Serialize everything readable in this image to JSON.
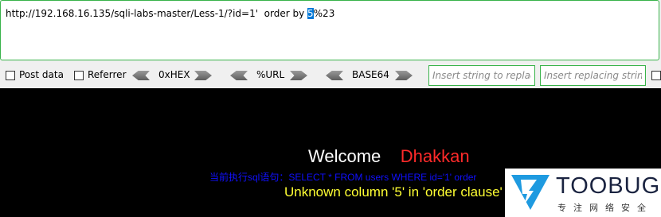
{
  "url_bar": {
    "prefix": "http://192.168.16.135/sqli-labs-master/Less-1/?id=1'  order by",
    "selected": "5",
    "suffix": "%23"
  },
  "toolbar": {
    "post_data_label": "Post data",
    "referrer_label": "Referrer",
    "hex_label": "0xHEX",
    "url_label": "%URL",
    "base64_label": "BASE64",
    "insert_string_placeholder": "Insert string to replace",
    "insert_replacing_placeholder": "Insert replacing string"
  },
  "page": {
    "welcome_text": "Welcome",
    "welcome_name": "Dhakkan",
    "sql_line": "当前执行sql语句：SELECT * FROM users WHERE id='1' order",
    "error_line": "Unknown column '5' in 'order clause'"
  },
  "watermark": {
    "brand": "TOOBUG",
    "subtitle": "专注网络安全"
  },
  "colors": {
    "accent_green": "#39b34a",
    "welcome_name": "#ff2a2a",
    "sql_blue": "#1010ff",
    "error_yellow": "#ffff33"
  }
}
